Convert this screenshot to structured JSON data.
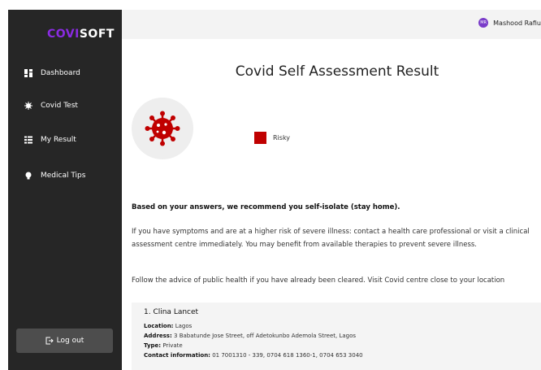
{
  "brand": {
    "part1": "COVI",
    "part2": "SOFT",
    "accent": "#8a2be2"
  },
  "sidebar": {
    "items": [
      {
        "label": "Dashboard",
        "icon": "dashboard-grid-icon"
      },
      {
        "label": "Covid Test",
        "icon": "virus-icon"
      },
      {
        "label": "My Result",
        "icon": "list-icon"
      },
      {
        "label": "Medical Tips",
        "icon": "lightbulb-icon"
      }
    ],
    "logout_label": "Log out"
  },
  "user": {
    "initials": "MR",
    "name": "Mashood Rafiu"
  },
  "result": {
    "title": "Covid Self Assessment Result",
    "status": "Risky",
    "status_color": "#c00000",
    "recommendation": "Based on your answers, we recommend you self-isolate (stay home).",
    "para1": "If you have symptoms and are at a higher risk of severe illness: contact a health care professional or visit a clinical assessment centre immediately. You may benefit from available therapies to prevent severe illness.",
    "para2": "Follow the advice of public health if you have already been cleared. Visit Covid centre close to your location"
  },
  "centre": {
    "name": "1. Clina Lancet",
    "location_label": "Location:",
    "location": "Lagos",
    "address_label": "Address:",
    "address": "3 Babatunde Jose Street, off Adetokunbo Ademola Street, Lagos",
    "type_label": "Type:",
    "type": "Private",
    "contact_label": "Contact information:",
    "contact": "01 7001310 - 339, 0704 618 1360-1, 0704 653 3040"
  }
}
